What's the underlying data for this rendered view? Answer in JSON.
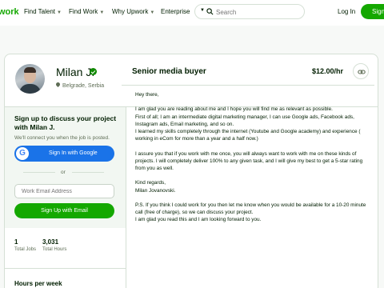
{
  "nav": {
    "logo": "work",
    "items": [
      {
        "label": "Find Talent"
      },
      {
        "label": "Find Work"
      },
      {
        "label": "Why Upwork"
      },
      {
        "label": "Enterprise"
      }
    ],
    "search_placeholder": "Search",
    "login": "Log In",
    "signup": "Sign"
  },
  "profile": {
    "name": "Milan J.",
    "location": "Belgrade, Serbia"
  },
  "cta": {
    "title": "Sign up to discuss your project with Milan J.",
    "subtitle": "We'll connect you when the job is posted.",
    "google_label": "Sign In with Google",
    "or": "or",
    "email_placeholder": "Work Email Address",
    "email_button": "Sign Up with Email"
  },
  "stats": [
    {
      "value": "1",
      "label": "Total Jobs"
    },
    {
      "value": "3,031",
      "label": "Total Hours"
    }
  ],
  "hours_heading": "Hours per week",
  "job": {
    "title": "Senior media buyer",
    "rate": "$12.00/hr"
  },
  "bio": [
    "Hey there,",
    "",
    "I am glad you are reading about me and I hope you will find me as relevant as possible.",
    "First of all; I am an intermediate digital marketing manager, I can use Google ads, Facebook ads, Instagram ads, Email marketing, and so on.",
    "I learned my skills completely through the internet (Youtube and Google academy) and experience ( working in eCom for more than a year and a half now.)",
    "",
    "I assure you that if you work with me once, you will always want to work with me on these kinds of projects. I will completely deliver 100% to any given task, and I will give my best to get a 5-star rating from you as well.",
    "",
    "Kind regards,",
    "Milan Jovanovski.",
    "",
    "P.S. If you think I could work for you then let me know when you would be available for a 10-20 minute call (free of charge), so we can discuss your project.",
    "I am glad you read this and I am looking forward to you."
  ],
  "colors": {
    "brand_green": "#14a800",
    "google_blue": "#1a73e8",
    "text": "#001e00",
    "muted": "#5e6d55"
  }
}
